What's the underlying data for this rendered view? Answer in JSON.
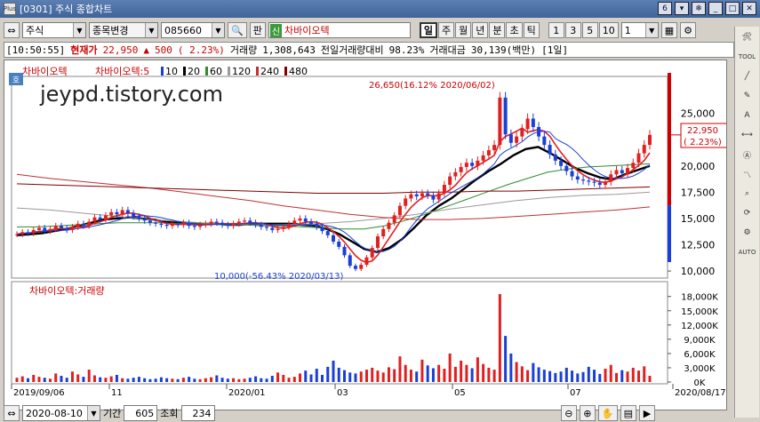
{
  "window": {
    "app_icon": "Plus",
    "title": "[0301] 주식 종합차트",
    "page_badge": "6"
  },
  "toolbar": {
    "market": "주식",
    "change_code_label": "종목변경",
    "code": "085660",
    "pan_label": "판",
    "sin_badge": "신",
    "stock_name": "차바이오텍",
    "periods": [
      "일",
      "주",
      "월",
      "년",
      "분",
      "초",
      "틱"
    ],
    "active_period": "일",
    "intervals": [
      "1",
      "3",
      "5",
      "10"
    ],
    "interval_value": "1"
  },
  "infobar": {
    "time": "[10:50:55]",
    "price_label": "현재가",
    "price": "22,950",
    "arrow": "▲",
    "change": "500",
    "change_pct": "( 2.23%)",
    "volume_label": "거래량",
    "volume": "1,308,643",
    "prev_volume_label": "전일거래량대비",
    "prev_volume_pct": "98.23%",
    "amount_label": "거래대금",
    "amount": "30,139(백만)",
    "period_tag": "[1일]"
  },
  "legend": {
    "name": "차바이오텍",
    "ma_prefix": "차바이오텍:5",
    "ma_items": [
      {
        "label": "10",
        "color": "#1a3fd6"
      },
      {
        "label": "20",
        "color": "#000000"
      },
      {
        "label": "60",
        "color": "#2e8b2e"
      },
      {
        "label": "120",
        "color": "#999999"
      },
      {
        "label": "240",
        "color": "#c03030"
      },
      {
        "label": "480",
        "color": "#800000"
      }
    ],
    "ho_badge": "호"
  },
  "watermark": "jeypd.tistory.com",
  "colors": {
    "up": "#e02020",
    "down": "#1a3fd6",
    "ma5": "#e02020",
    "ma10": "#1a3fd6",
    "ma20": "#000000",
    "ma60": "#2e8b2e",
    "ma120": "#999999",
    "ma240": "#c03030",
    "ma480": "#800000"
  },
  "chart_data": {
    "type": "line",
    "price_axis": {
      "range": [
        9500,
        27500
      ],
      "ticks": [
        "25,000",
        "22,500",
        "20,000",
        "17,500",
        "15,000",
        "12,500",
        "10,000"
      ]
    },
    "x_labels": [
      "2019/09/06",
      "11",
      "2020/01",
      "03",
      "05",
      "07",
      "2020/08/17"
    ],
    "annotations": {
      "high": "26,650(16.12% 2020/06/02)",
      "low": "10,000(-56.43% 2020/03/13)"
    },
    "current_price_tag": "22,950",
    "current_change_tag": "( 2.23%)",
    "price_series": [
      13500,
      13700,
      13600,
      13900,
      14100,
      13800,
      14000,
      14300,
      14100,
      13900,
      14200,
      14500,
      14300,
      14700,
      15100,
      14900,
      15300,
      15600,
      15400,
      15800,
      15500,
      15200,
      15000,
      14800,
      14600,
      14500,
      14400,
      14300,
      14500,
      14400,
      14600,
      14300,
      14200,
      14400,
      14500,
      14700,
      14600,
      14400,
      14300,
      14500,
      14700,
      14800,
      14600,
      14400,
      14200,
      14100,
      13900,
      14000,
      14200,
      14500,
      14800,
      15000,
      14700,
      14500,
      14200,
      13800,
      13400,
      12800,
      12300,
      11500,
      10500,
      10200,
      10600,
      11300,
      12200,
      13300,
      14000,
      14600,
      15300,
      16200,
      16900,
      17300,
      17100,
      17400,
      17200,
      16800,
      17400,
      18200,
      19000,
      19400,
      19900,
      20300,
      20000,
      20500,
      21000,
      21500,
      22000,
      26500,
      23000,
      22200,
      22800,
      23500,
      24500,
      23700,
      22800,
      22000,
      21100,
      20500,
      20000,
      19500,
      19000,
      18700,
      18600,
      18500,
      18400,
      18200,
      18500,
      19200,
      19600,
      19300,
      19800,
      20300,
      21200,
      22000,
      22950
    ],
    "ma_series": [
      {
        "name": "20",
        "values": [
          13400,
          13500,
          13600,
          13800,
          14000,
          14300,
          14600,
          14900,
          15000,
          15100,
          15000,
          14900,
          14700,
          14600,
          14500,
          14500,
          14500,
          14400,
          14400,
          14500,
          14500,
          14500,
          14500,
          14400,
          14300,
          14000,
          13500,
          12800,
          12100,
          11800,
          12200,
          13000,
          14100,
          15300,
          16200,
          16900,
          17800,
          18700,
          19500,
          20200,
          21000,
          21600,
          21800,
          21200,
          20500,
          19800,
          19300,
          18900,
          18700,
          19200,
          19600,
          20000
        ]
      },
      {
        "name": "60",
        "values": [
          14200,
          14200,
          14300,
          14400,
          14500,
          14600,
          14600,
          14600,
          14500,
          14500,
          14400,
          14400,
          14300,
          14300,
          14200,
          14100,
          14000,
          14000,
          14300,
          14800,
          15400,
          16100,
          16800,
          17500,
          18200,
          18800,
          19400,
          19700,
          19900,
          20000,
          20100,
          20200
        ]
      },
      {
        "name": "120",
        "values": [
          16000,
          15800,
          15500,
          15200,
          14900,
          14700,
          14500,
          14400,
          14400,
          14500,
          14700,
          15000,
          15400,
          15900,
          16300,
          16700,
          17000,
          17200,
          17300,
          17500
        ]
      },
      {
        "name": "240",
        "values": [
          19200,
          18800,
          18500,
          18200,
          17900,
          17500,
          17100,
          16700,
          16200,
          15800,
          15400,
          15100,
          14900,
          14900,
          15000,
          15200,
          15400,
          15600,
          15800,
          16100
        ]
      },
      {
        "name": "480",
        "values": [
          18300,
          18200,
          18100,
          18000,
          17900,
          17800,
          17700,
          17600,
          17500,
          17400,
          17400,
          17400,
          17500,
          17500,
          17600,
          17600,
          17700,
          17800,
          17900,
          18000
        ]
      }
    ],
    "volume_title": "차바이오텍:거래량",
    "volume_axis": {
      "range": [
        0,
        20000
      ],
      "ticks": [
        "18,000K",
        "15,000K",
        "12,000K",
        "9,000K",
        "6,000K",
        "3,000K",
        "0K"
      ]
    },
    "volume_series": [
      900,
      1200,
      800,
      1500,
      1100,
      900,
      700,
      1800,
      1300,
      900,
      2200,
      1600,
      1100,
      2600,
      1400,
      1000,
      900,
      1200,
      1500,
      800,
      700,
      900,
      1100,
      800,
      600,
      700,
      1000,
      800,
      700,
      600,
      900,
      1100,
      700,
      600,
      800,
      1000,
      1400,
      900,
      700,
      800,
      600,
      700,
      900,
      1200,
      800,
      700,
      1300,
      2000,
      1500,
      900,
      1100,
      1800,
      2400,
      1600,
      2800,
      1500,
      3200,
      4500,
      3000,
      2500,
      2000,
      1800,
      2200,
      2600,
      3000,
      2400,
      2000,
      3100,
      2700,
      5400,
      3600,
      2600,
      2200,
      4700,
      3500,
      2900,
      3600,
      2800,
      6000,
      3200,
      4500,
      3600,
      2900,
      5200,
      3800,
      3000,
      2600,
      18500,
      9700,
      6000,
      4200,
      3300,
      2500,
      4000,
      3100,
      2600,
      2300,
      1900,
      2200,
      3000,
      2400,
      1800,
      2100,
      3200,
      2600,
      1700,
      2800,
      3600,
      1900,
      2500,
      2200,
      3000,
      2400,
      3300,
      1300
    ],
    "volume_colors": "up-red/down-blue alternating per candle"
  },
  "bottombar": {
    "date": "2020-08-10",
    "period_label": "기간",
    "period_count": "605",
    "view_label": "조회",
    "view_count": "234"
  },
  "sidebar_icons": [
    "tool-icon",
    "trend-line-icon",
    "draw-icon",
    "text-icon",
    "measure-icon",
    "auto-icon",
    "pattern-icon",
    "zoom-icon",
    "refresh-icon",
    "settings-icon"
  ],
  "sidebar_auto_label": "AUTO",
  "sidebar_tool_label": "TOOL"
}
